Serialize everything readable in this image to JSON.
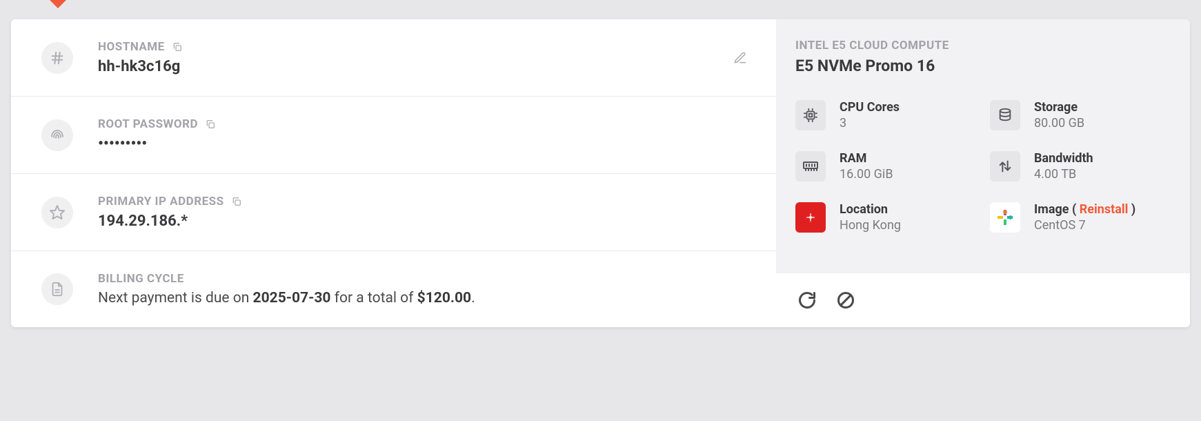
{
  "hostname": {
    "label": "HOSTNAME",
    "value": "hh-hk3c16g"
  },
  "root_password": {
    "label": "ROOT PASSWORD",
    "value": "•••••••••"
  },
  "primary_ip": {
    "label": "PRIMARY IP ADDRESS",
    "value": "194.29.186.*"
  },
  "billing": {
    "label": "BILLING CYCLE",
    "prefix": "Next payment is due on ",
    "date": "2025-07-30",
    "middle": " for a total of ",
    "amount": "$120.00",
    "suffix": "."
  },
  "plan": {
    "kicker": "INTEL E5 CLOUD COMPUTE",
    "name": "E5 NVMe Promo 16"
  },
  "specs": {
    "cpu": {
      "label": "CPU Cores",
      "value": "3"
    },
    "storage": {
      "label": "Storage",
      "value": "80.00 GB"
    },
    "ram": {
      "label": "RAM",
      "value": "16.00 GiB"
    },
    "bandwidth": {
      "label": "Bandwidth",
      "value": "4.00 TB"
    },
    "location": {
      "label": "Location",
      "value": "Hong Kong"
    },
    "image": {
      "label": "Image",
      "reinstall_open": "( ",
      "reinstall": "Reinstall",
      "reinstall_close": " )",
      "value": "CentOS 7"
    }
  }
}
